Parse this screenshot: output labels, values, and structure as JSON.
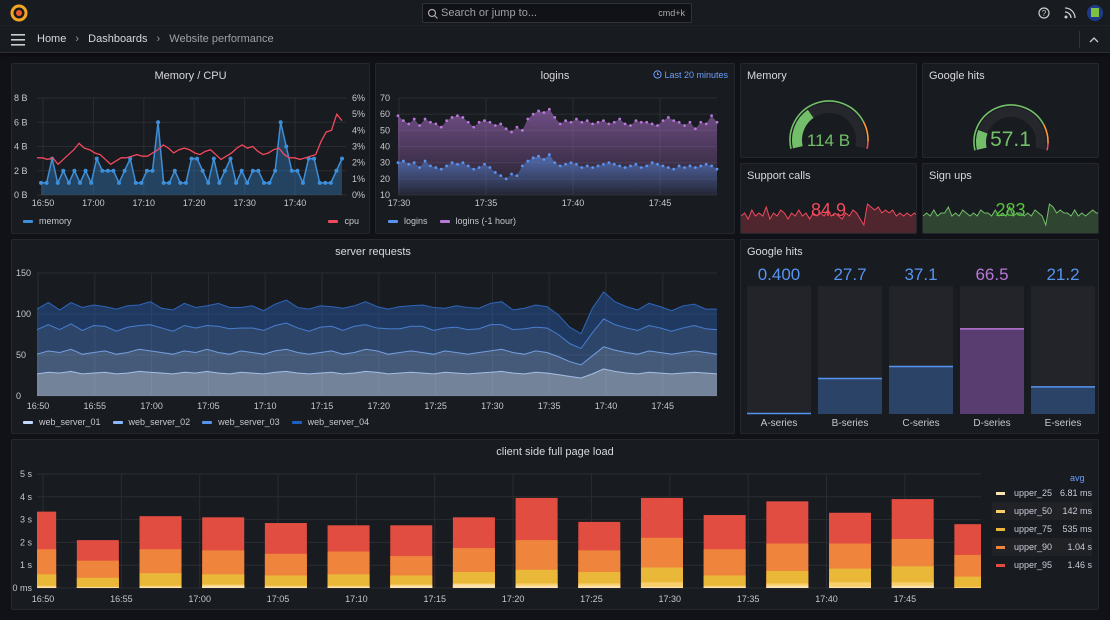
{
  "topbar": {
    "search_placeholder": "Search or jump to...",
    "shortcut": "cmd+k"
  },
  "breadcrumb": [
    "Home",
    "Dashboards",
    "Website performance"
  ],
  "colors": {
    "bg": "#111217",
    "panel": "#181b1f",
    "blue": "#5794f2",
    "memory": "#3d8fd9",
    "cpu": "#f2495c",
    "purple": "#b877d9",
    "green": "#73bf69",
    "red": "#f2495c",
    "orange": "#ff9830"
  },
  "panels": {
    "memcpu": {
      "title": "Memory / CPU",
      "legend": [
        "memory",
        "cpu"
      ]
    },
    "logins": {
      "title": "logins",
      "time_range": "Last 20 minutes",
      "legend": [
        "logins",
        "logins (-1 hour)"
      ]
    },
    "memory_gauge": {
      "title": "Memory",
      "value": "114 B"
    },
    "google_gauge": {
      "title": "Google hits",
      "value": "57.1"
    },
    "support": {
      "title": "Support calls",
      "value": "84.9"
    },
    "signups": {
      "title": "Sign ups",
      "value": "283"
    },
    "server": {
      "title": "server requests",
      "legend": [
        "web_server_01",
        "web_server_02",
        "web_server_03",
        "web_server_04"
      ]
    },
    "bargauge": {
      "title": "Google hits"
    },
    "client": {
      "title": "client side full page load",
      "legend_header": "avg"
    }
  },
  "chart_data": [
    {
      "id": "memcpu",
      "type": "line",
      "title": "Memory / CPU",
      "start": "16:49",
      "step_min": 1,
      "yleft": {
        "ticks": [
          "0 B",
          "2 B",
          "4 B",
          "6 B",
          "8 B"
        ],
        "range": [
          0,
          8
        ]
      },
      "yright": {
        "ticks": [
          "0%",
          "1%",
          "2%",
          "3%",
          "4%",
          "5%",
          "6%"
        ],
        "range": [
          0,
          6
        ]
      },
      "xticks": [
        "16:50",
        "17:00",
        "17:10",
        "17:20",
        "17:30",
        "17:40"
      ],
      "series": [
        {
          "name": "memory",
          "axis": "left",
          "color": "#3d8fd9",
          "values": [
            1,
            1,
            3,
            1,
            2,
            1,
            2,
            1,
            2,
            1,
            3,
            2,
            2,
            2,
            1,
            2,
            3,
            1,
            1,
            2,
            2,
            6,
            1,
            1,
            2,
            1,
            1,
            3,
            3,
            2,
            1,
            3,
            1,
            2,
            3,
            1,
            2,
            1,
            2,
            2,
            1,
            1,
            2,
            6,
            4,
            2,
            2,
            1,
            3,
            3,
            1,
            1,
            1,
            2,
            3
          ]
        },
        {
          "name": "cpu",
          "axis": "right",
          "color": "#f2495c",
          "values": [
            2.3,
            2.3,
            2.2,
            2.3,
            1.9,
            2.2,
            2.5,
            2.8,
            3.2,
            2.9,
            2.8,
            2.6,
            2.5,
            2.2,
            1.9,
            2.1,
            2.3,
            2.3,
            2.4,
            2.5,
            2.4,
            2.4,
            2.6,
            2.8,
            3.1,
            2.9,
            2.6,
            2.8,
            2.9,
            2.8,
            2.6,
            2.5,
            2.7,
            2.8,
            2.5,
            2.2,
            2.4,
            2.6,
            2.9,
            3.1,
            2.9,
            3.0,
            2.7,
            2.5,
            2.6,
            2.8,
            2.9,
            2.5,
            2.3,
            2.3,
            2.2,
            2.3,
            2.4,
            2.5,
            3.3,
            3.9,
            4.0,
            5.0,
            4.6
          ]
        }
      ]
    },
    {
      "id": "logins",
      "type": "line",
      "title": "logins",
      "start": "17:30",
      "step_sec": 20,
      "yticks": [
        10,
        20,
        30,
        40,
        50,
        60,
        70
      ],
      "range": [
        10,
        70
      ],
      "xticks": [
        "17:30",
        "17:35",
        "17:40",
        "17:45"
      ],
      "series": [
        {
          "name": "logins",
          "color": "#5794f2",
          "values": [
            30,
            31,
            29,
            30,
            27,
            31,
            28,
            27,
            26,
            28,
            30,
            29,
            30,
            28,
            26,
            27,
            29,
            27,
            24,
            22,
            20,
            23,
            22,
            28,
            31,
            33,
            34,
            32,
            35,
            30,
            28,
            29,
            30,
            29,
            27,
            28,
            27,
            28,
            29,
            30,
            29,
            28,
            27,
            28,
            29,
            27,
            28,
            30,
            29,
            28,
            27,
            26,
            28,
            27,
            28,
            27,
            28,
            29,
            28,
            26
          ]
        },
        {
          "name": "logins (-1 hour)",
          "color": "#b877d9",
          "values": [
            59,
            56,
            54,
            57,
            53,
            57,
            55,
            54,
            52,
            56,
            58,
            59,
            58,
            55,
            52,
            55,
            56,
            55,
            53,
            54,
            51,
            49,
            52,
            50,
            57,
            60,
            62,
            61,
            63,
            58,
            54,
            56,
            55,
            57,
            55,
            56,
            54,
            55,
            56,
            54,
            55,
            57,
            54,
            53,
            56,
            55,
            55,
            54,
            53,
            56,
            58,
            56,
            55,
            53,
            55,
            51,
            55,
            54,
            59,
            55
          ]
        }
      ]
    },
    {
      "id": "server",
      "type": "area",
      "stacked": true,
      "title": "server requests",
      "start": "16:49",
      "step_min": 1,
      "yticks": [
        0,
        50,
        100,
        150
      ],
      "range": [
        0,
        150
      ],
      "xticks": [
        "16:50",
        "16:55",
        "17:00",
        "17:05",
        "17:10",
        "17:15",
        "17:20",
        "17:25",
        "17:30",
        "17:35",
        "17:40",
        "17:45"
      ],
      "series": [
        {
          "name": "web_server_01",
          "color": "#c0d8ff",
          "values": [
            27,
            29,
            28,
            30,
            27,
            28,
            29,
            27,
            28,
            30,
            29,
            28,
            27,
            29,
            28,
            30,
            28,
            27,
            29,
            28,
            27,
            29,
            30,
            28,
            27,
            28,
            29,
            27,
            28,
            30,
            29,
            27,
            28,
            29,
            28,
            27,
            29,
            28,
            27,
            28,
            29,
            30,
            28,
            27,
            29,
            28,
            26,
            24,
            22,
            27,
            33,
            30,
            28,
            27,
            29,
            28,
            27,
            28,
            29,
            28,
            27
          ]
        },
        {
          "name": "web_server_02",
          "color": "#8ab8ff",
          "values": [
            24,
            26,
            25,
            27,
            24,
            25,
            26,
            24,
            25,
            27,
            26,
            25,
            24,
            26,
            25,
            27,
            25,
            24,
            26,
            25,
            24,
            26,
            27,
            25,
            24,
            25,
            26,
            24,
            25,
            27,
            26,
            24,
            25,
            26,
            25,
            24,
            26,
            25,
            24,
            25,
            26,
            27,
            25,
            24,
            26,
            25,
            22,
            18,
            16,
            22,
            27,
            26,
            25,
            24,
            26,
            25,
            24,
            25,
            26,
            25,
            24
          ]
        },
        {
          "name": "web_server_03",
          "color": "#5794f2",
          "values": [
            30,
            32,
            28,
            31,
            29,
            33,
            30,
            28,
            31,
            29,
            32,
            30,
            28,
            31,
            30,
            29,
            32,
            31,
            28,
            30,
            29,
            31,
            32,
            30,
            28,
            31,
            30,
            29,
            32,
            30,
            28,
            31,
            29,
            30,
            32,
            29,
            28,
            31,
            30,
            29,
            32,
            30,
            28,
            31,
            29,
            30,
            27,
            22,
            20,
            28,
            34,
            31,
            30,
            29,
            31,
            30,
            28,
            30,
            31,
            29,
            30
          ]
        },
        {
          "name": "web_server_04",
          "color": "#3274d9",
          "values": [
            25,
            27,
            24,
            26,
            28,
            25,
            24,
            27,
            26,
            25,
            28,
            24,
            26,
            27,
            25,
            24,
            28,
            26,
            25,
            27,
            24,
            26,
            28,
            25,
            27,
            26,
            24,
            27,
            25,
            28,
            26,
            24,
            27,
            25,
            26,
            28,
            24,
            26,
            27,
            25,
            26,
            28,
            24,
            25,
            27,
            26,
            24,
            20,
            18,
            30,
            33,
            28,
            26,
            25,
            27,
            26,
            25,
            27,
            26,
            24,
            25
          ]
        }
      ]
    },
    {
      "id": "bargauge",
      "type": "bar",
      "title": "Google hits",
      "categories": [
        "A-series",
        "B-series",
        "C-series",
        "D-series",
        "E-series"
      ],
      "labels": [
        "0.400",
        "27.7",
        "37.1",
        "66.5",
        "21.2"
      ],
      "values": [
        0.4,
        27.7,
        37.1,
        66.5,
        21.2
      ],
      "fill_percent": [
        0.4,
        27.7,
        37.1,
        66.5,
        21.2
      ],
      "range": [
        0,
        100
      ],
      "colors": [
        "#5794f2",
        "#5794f2",
        "#5794f2",
        "#b877d9",
        "#5794f2"
      ]
    },
    {
      "id": "client",
      "type": "bar",
      "stacked": false,
      "title": "client side full page load",
      "yticks": [
        "0 ms",
        "1 s",
        "2 s",
        "3 s",
        "4 s",
        "5 s"
      ],
      "range": [
        0,
        5
      ],
      "xticks": [
        "16:50",
        "16:55",
        "17:00",
        "17:05",
        "17:10",
        "17:15",
        "17:20",
        "17:25",
        "17:30",
        "17:35",
        "17:40",
        "17:45"
      ],
      "x": [
        "16:49:30",
        "16:53:30",
        "16:57:30",
        "17:01:30",
        "17:05:30",
        "17:09:30",
        "17:13:30",
        "17:17:30",
        "17:21:30",
        "17:25:30",
        "17:29:30",
        "17:33:30",
        "17:37:30",
        "17:41:30",
        "17:45:30",
        "17:49:30"
      ],
      "series": [
        {
          "name": "upper_25",
          "avg": "6.81 ms",
          "color": "#fce2b0",
          "values": [
            0.05,
            0.03,
            0.05,
            0.1,
            0.05,
            0.05,
            0.1,
            0.15,
            0.1,
            0.1,
            0.05,
            0.05,
            0.1,
            0.05,
            0.1,
            0.0
          ]
        },
        {
          "name": "upper_50",
          "avg": "142 ms",
          "color": "#f8d06b",
          "values": [
            0.1,
            0.05,
            0.1,
            0.15,
            0.1,
            0.1,
            0.15,
            0.2,
            0.2,
            0.2,
            0.25,
            0.1,
            0.2,
            0.25,
            0.25,
            0.05
          ]
        },
        {
          "name": "upper_75",
          "avg": "535 ms",
          "color": "#eab839",
          "values": [
            0.6,
            0.45,
            0.65,
            0.6,
            0.55,
            0.6,
            0.55,
            0.7,
            0.8,
            0.7,
            0.9,
            0.55,
            0.75,
            0.85,
            0.95,
            0.5
          ]
        },
        {
          "name": "upper_90",
          "avg": "1.04 s",
          "color": "#ef843c",
          "values": [
            1.7,
            1.2,
            1.7,
            1.65,
            1.5,
            1.6,
            1.4,
            1.75,
            2.1,
            1.65,
            2.2,
            1.7,
            1.95,
            1.95,
            2.15,
            1.45
          ]
        },
        {
          "name": "upper_95",
          "avg": "1.46 s",
          "color": "#e24d42",
          "values": [
            3.35,
            2.1,
            3.15,
            3.1,
            2.85,
            2.75,
            2.75,
            3.1,
            3.95,
            2.9,
            3.95,
            3.2,
            3.8,
            3.3,
            3.9,
            2.8
          ]
        }
      ]
    },
    {
      "id": "gauges",
      "type": "gauge",
      "items": [
        {
          "title": "Memory",
          "value": "114 B",
          "level": 0.33
        },
        {
          "title": "Google hits",
          "value": "57.1",
          "level": 0.16
        }
      ]
    },
    {
      "id": "sparks",
      "type": "area",
      "items": [
        {
          "title": "Support calls",
          "color": "#f2495c",
          "values": [
            5,
            6,
            4,
            7,
            5,
            6,
            5,
            8,
            4,
            6,
            5,
            7,
            6,
            4,
            6,
            5,
            7,
            5,
            6,
            4,
            6,
            5,
            6,
            5,
            7,
            5,
            6,
            5,
            4,
            6,
            5,
            7,
            6,
            4,
            2,
            9,
            8,
            7,
            8,
            6,
            7,
            6,
            7,
            5,
            6,
            5,
            6,
            5,
            6,
            5
          ]
        },
        {
          "title": "Sign ups",
          "color": "#73bf69",
          "values": [
            5,
            6,
            5,
            7,
            5,
            6,
            6,
            8,
            5,
            6,
            5,
            7,
            6,
            5,
            6,
            5,
            7,
            6,
            6,
            5,
            7,
            5,
            6,
            5,
            8,
            5,
            6,
            6,
            5,
            6,
            5,
            7,
            6,
            5,
            2,
            9,
            8,
            6,
            7,
            6,
            6,
            5,
            7,
            5,
            6,
            5,
            6,
            7,
            6,
            6
          ]
        }
      ]
    }
  ]
}
